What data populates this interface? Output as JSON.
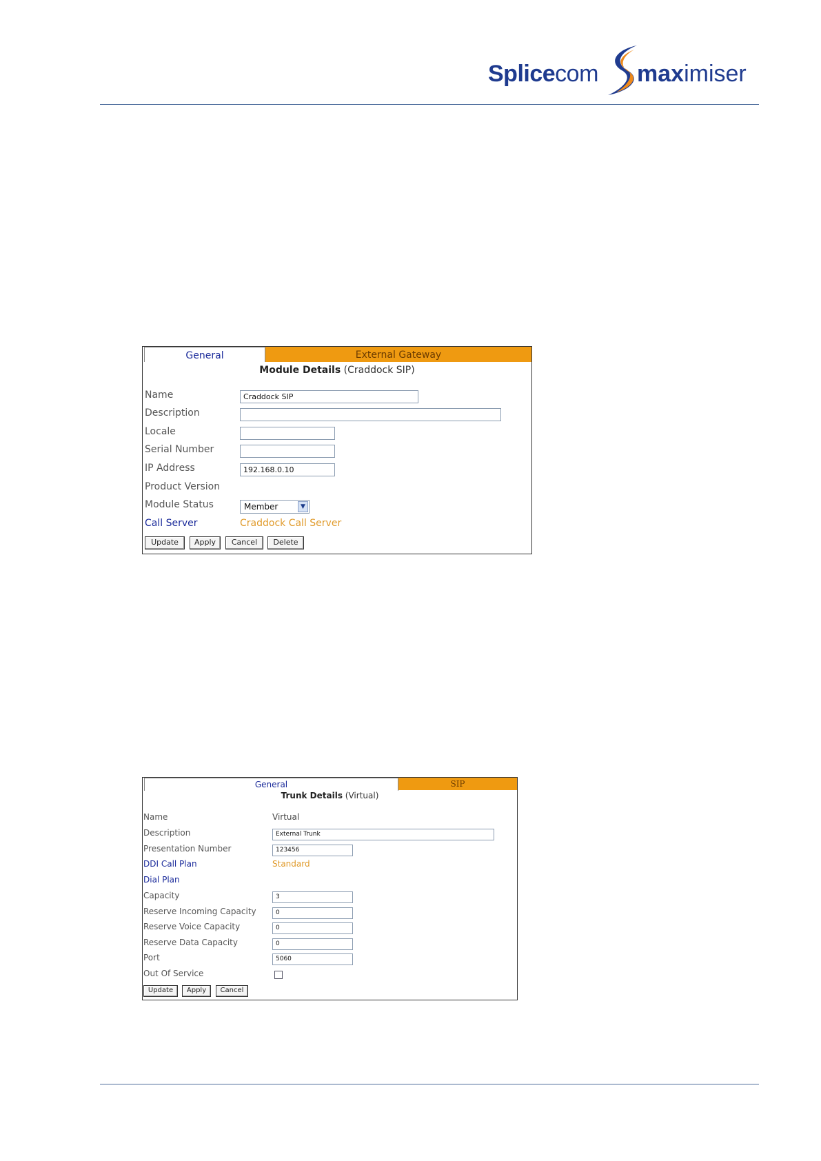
{
  "header": {
    "logo_splice": "Splice",
    "logo_com": "com",
    "logo_max": "max",
    "logo_imiser": "imiser"
  },
  "module_panel": {
    "tabs": [
      {
        "label": "General",
        "active": true
      },
      {
        "label": "External Gateway",
        "active": false
      }
    ],
    "title_bold": "Module Details",
    "title_rest": "(Craddock SIP)",
    "fields": {
      "name": {
        "label": "Name",
        "value": "Craddock SIP"
      },
      "description": {
        "label": "Description",
        "value": ""
      },
      "locale": {
        "label": "Locale",
        "value": ""
      },
      "serial_number": {
        "label": "Serial Number",
        "value": ""
      },
      "ip_address": {
        "label": "IP Address",
        "value": "192.168.0.10"
      },
      "product_version": {
        "label": "Product Version",
        "value": ""
      },
      "module_status": {
        "label": "Module Status",
        "value": "Member"
      },
      "call_server": {
        "label": "Call Server",
        "value": "Craddock Call Server"
      }
    },
    "buttons": {
      "update": "Update",
      "apply": "Apply",
      "cancel": "Cancel",
      "delete": "Delete"
    }
  },
  "trunk_panel": {
    "tabs": [
      {
        "label": "General",
        "active": true
      },
      {
        "label": "SIP",
        "active": false
      }
    ],
    "title_bold": "Trunk Details",
    "title_rest": "(Virtual)",
    "fields": {
      "name": {
        "label": "Name",
        "value": "Virtual"
      },
      "description": {
        "label": "Description",
        "value": "External Trunk"
      },
      "presentation_number": {
        "label": "Presentation Number",
        "value": "123456"
      },
      "ddi_call_plan": {
        "label": "DDI Call Plan",
        "value": "Standard"
      },
      "dial_plan": {
        "label": "Dial Plan",
        "value": ""
      },
      "capacity": {
        "label": "Capacity",
        "value": "3"
      },
      "reserve_incoming": {
        "label": "Reserve Incoming Capacity",
        "value": "0"
      },
      "reserve_voice": {
        "label": "Reserve Voice Capacity",
        "value": "0"
      },
      "reserve_data": {
        "label": "Reserve Data Capacity",
        "value": "0"
      },
      "port": {
        "label": "Port",
        "value": "5060"
      },
      "out_of_service": {
        "label": "Out Of Service",
        "checked": false
      }
    },
    "buttons": {
      "update": "Update",
      "apply": "Apply",
      "cancel": "Cancel"
    }
  },
  "colors": {
    "accent_blue": "#1a2a9a",
    "tab_orange": "#ef9a11",
    "link_orange": "#e09a2a",
    "rule_blue": "#4a6a9a"
  }
}
